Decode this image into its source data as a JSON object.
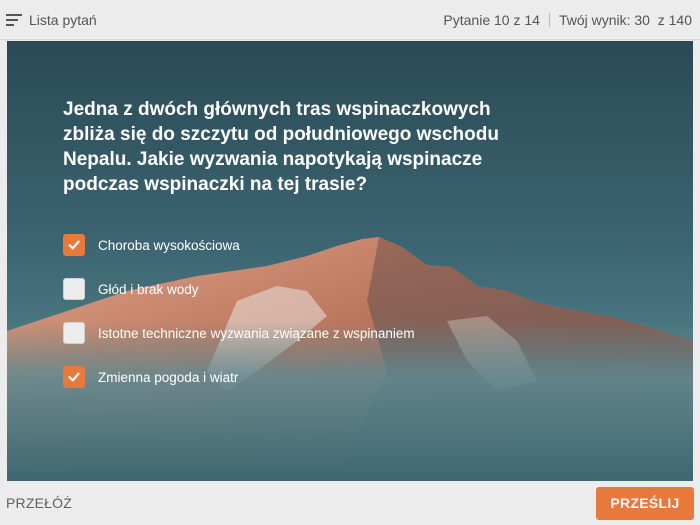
{
  "topbar": {
    "list_label": "Lista pytań",
    "progress_text": "Pytanie 10 z 14",
    "score_text": "Twój wynik: 30  z 140"
  },
  "question": {
    "text": "Jedna z dwóch głównych tras wspinaczkowych zbliża się do szczytu od południowego wschodu Nepalu. Jakie wyzwania napotykają wspinacze podczas wspinaczki na tej trasie?"
  },
  "options": [
    {
      "label": "Choroba wysokościowa",
      "checked": true
    },
    {
      "label": "Głód i brak wody",
      "checked": false
    },
    {
      "label": "Istotne techniczne wyzwania związane z wspinaniem",
      "checked": false
    },
    {
      "label": "Zmienna pogoda i wiatr",
      "checked": true
    }
  ],
  "footer": {
    "skip_label": "PRZEŁÓŻ",
    "submit_label": "PRZEŚLIJ"
  },
  "colors": {
    "accent": "#e8793c",
    "sky": "#3b6470"
  },
  "icons": {
    "list": "list-icon",
    "check": "check-icon"
  }
}
